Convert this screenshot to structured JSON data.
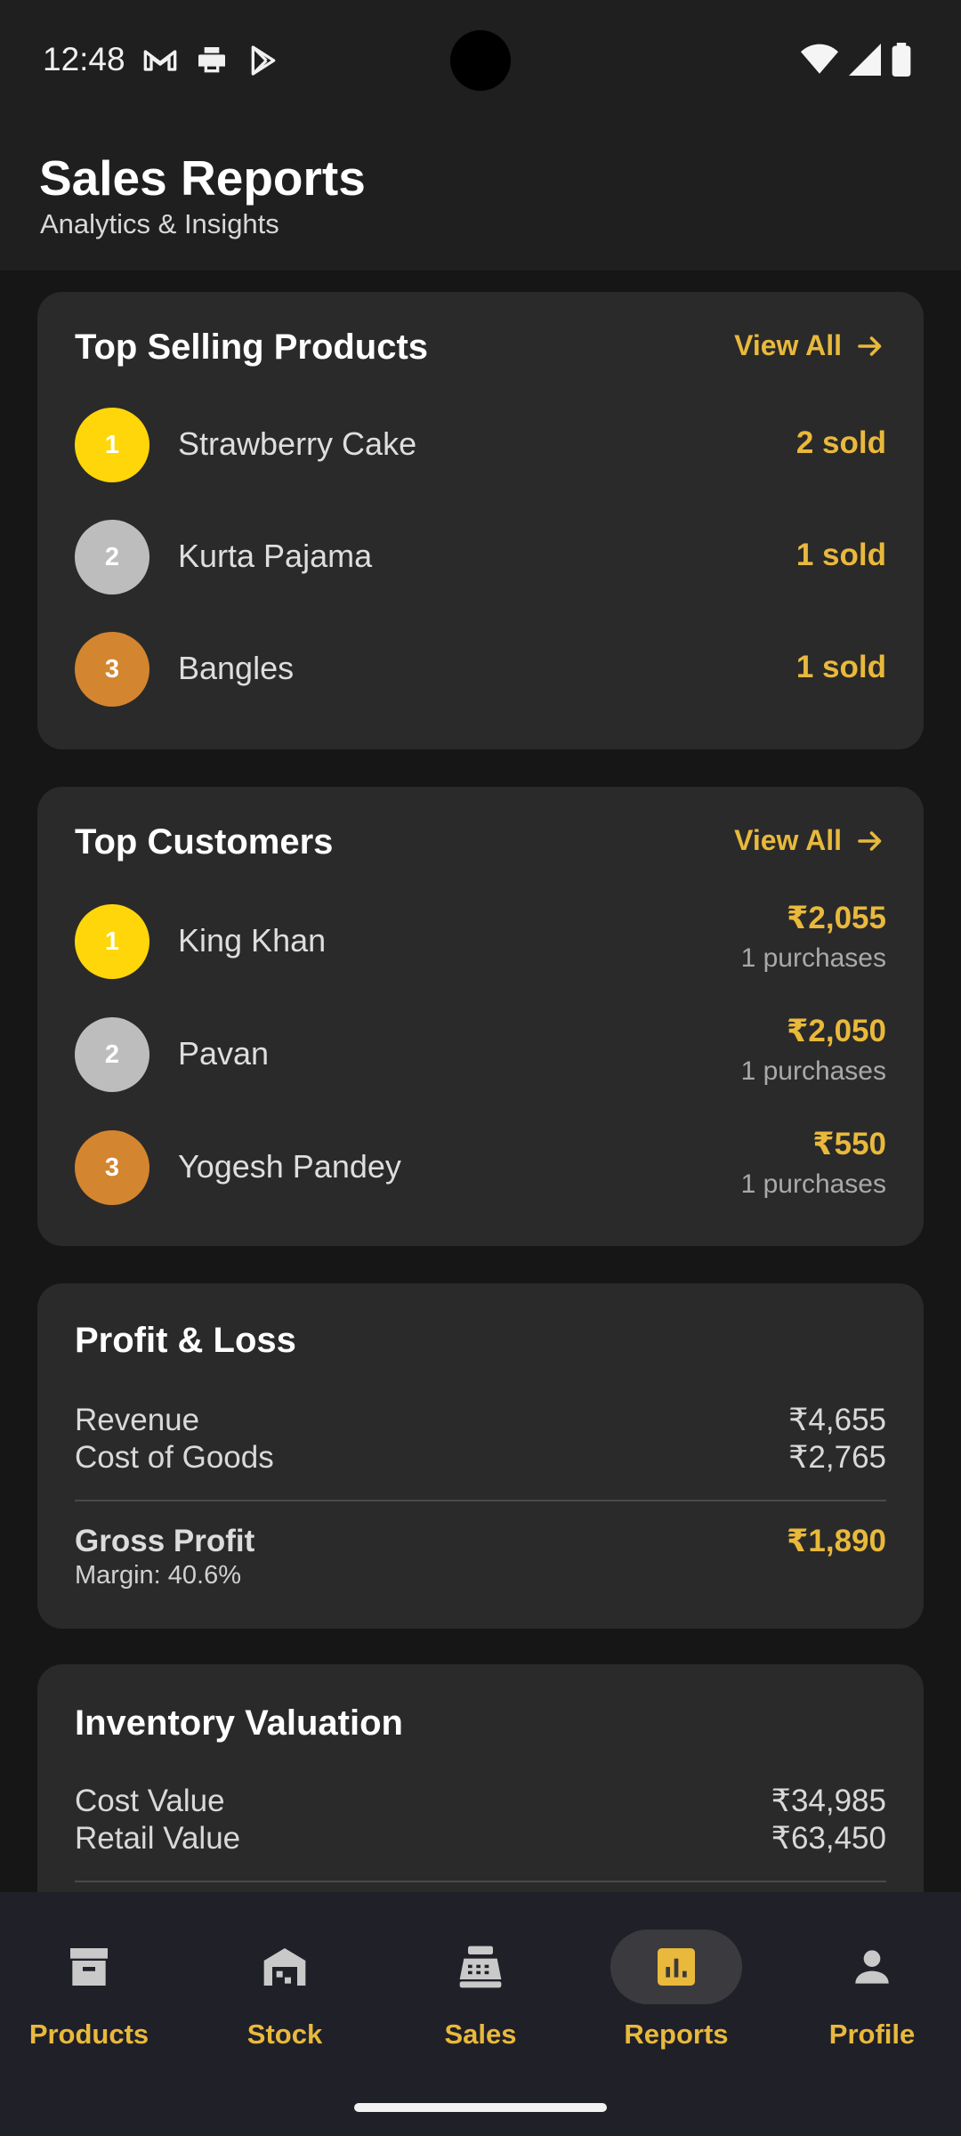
{
  "status_bar": {
    "time": "12:48"
  },
  "header": {
    "title": "Sales Reports",
    "subtitle": "Analytics & Insights"
  },
  "top_products": {
    "title": "Top Selling Products",
    "view_all": "View All",
    "items": [
      {
        "rank": "1",
        "name": "Strawberry Cake",
        "value": "2 sold"
      },
      {
        "rank": "2",
        "name": "Kurta Pajama",
        "value": "1 sold"
      },
      {
        "rank": "3",
        "name": "Bangles",
        "value": "1 sold"
      }
    ]
  },
  "top_customers": {
    "title": "Top Customers",
    "view_all": "View All",
    "items": [
      {
        "rank": "1",
        "name": "King Khan",
        "amount": "₹2,055",
        "purchases": "1 purchases"
      },
      {
        "rank": "2",
        "name": "Pavan",
        "amount": "₹2,050",
        "purchases": "1 purchases"
      },
      {
        "rank": "3",
        "name": "Yogesh Pandey",
        "amount": "₹550",
        "purchases": "1 purchases"
      }
    ]
  },
  "profit_loss": {
    "title": "Profit & Loss",
    "revenue_label": "Revenue",
    "revenue_value": "₹4,655",
    "cogs_label": "Cost of Goods",
    "cogs_value": "₹2,765",
    "gross_profit_label": "Gross Profit",
    "gross_profit_value": "₹1,890",
    "margin": "Margin: 40.6%"
  },
  "inventory": {
    "title": "Inventory Valuation",
    "cost_label": "Cost Value",
    "cost_value": "₹34,985",
    "retail_label": "Retail Value",
    "retail_value": "₹63,450"
  },
  "nav": {
    "active": "Reports",
    "items": [
      {
        "label": "Products",
        "icon": "archive-box-icon"
      },
      {
        "label": "Stock",
        "icon": "warehouse-icon"
      },
      {
        "label": "Sales",
        "icon": "cash-register-icon"
      },
      {
        "label": "Reports",
        "icon": "bar-chart-icon"
      },
      {
        "label": "Profile",
        "icon": "person-icon"
      }
    ]
  },
  "colors": {
    "accent": "#e9b93c",
    "gold": "#ffd60a",
    "silver": "#bdbdbd",
    "bronze": "#d4852f",
    "card": "#2a2a2a"
  }
}
